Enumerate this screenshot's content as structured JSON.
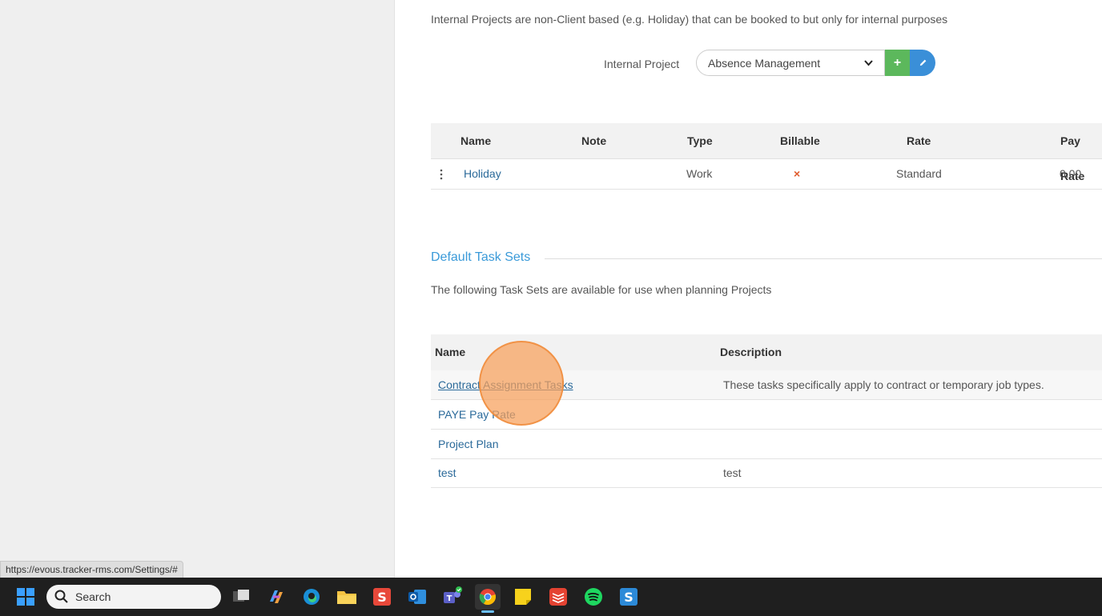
{
  "internal_projects": {
    "intro": "Internal Projects are non-Client based (e.g. Holiday) that can be booked to but only for internal purposes",
    "label": "Internal Project",
    "selected": "Absence Management",
    "add_label": "+",
    "columns": [
      "Name",
      "Note",
      "Type",
      "Billable",
      "Rate",
      "Pay Rate"
    ],
    "rows": [
      {
        "name": "Holiday",
        "note": "",
        "type": "Work",
        "billable": "×",
        "rate": "Standard",
        "pay_rate": "0.00"
      }
    ]
  },
  "task_sets": {
    "title": "Default Task Sets",
    "description": "The following Task Sets are available for use when planning Projects",
    "columns": [
      "Name",
      "Description"
    ],
    "rows": [
      {
        "name": "Contract Assignment Tasks",
        "description": "These tasks specifically apply to contract or temporary job types."
      },
      {
        "name": "PAYE Pay Rate",
        "description": ""
      },
      {
        "name": "Project Plan",
        "description": ""
      },
      {
        "name": "test",
        "description": "test"
      }
    ]
  },
  "status_url": "https://evous.tracker-rms.com/Settings/#",
  "taskbar": {
    "search_placeholder": "Search",
    "apps": [
      "file-explorer-task-view-icon",
      "copilot-icon",
      "edge-icon",
      "folder-icon",
      "snagit-icon",
      "outlook-icon",
      "teams-icon",
      "chrome-icon",
      "sticky-notes-icon",
      "todoist-icon",
      "spotify-icon",
      "snagit-editor-icon"
    ]
  },
  "colors": {
    "accent": "#3a9ad9",
    "link": "#2b6a9a",
    "add_green": "#5cb85c",
    "edit_blue": "#3a8fd8",
    "billable_x": "#e05a2b"
  }
}
